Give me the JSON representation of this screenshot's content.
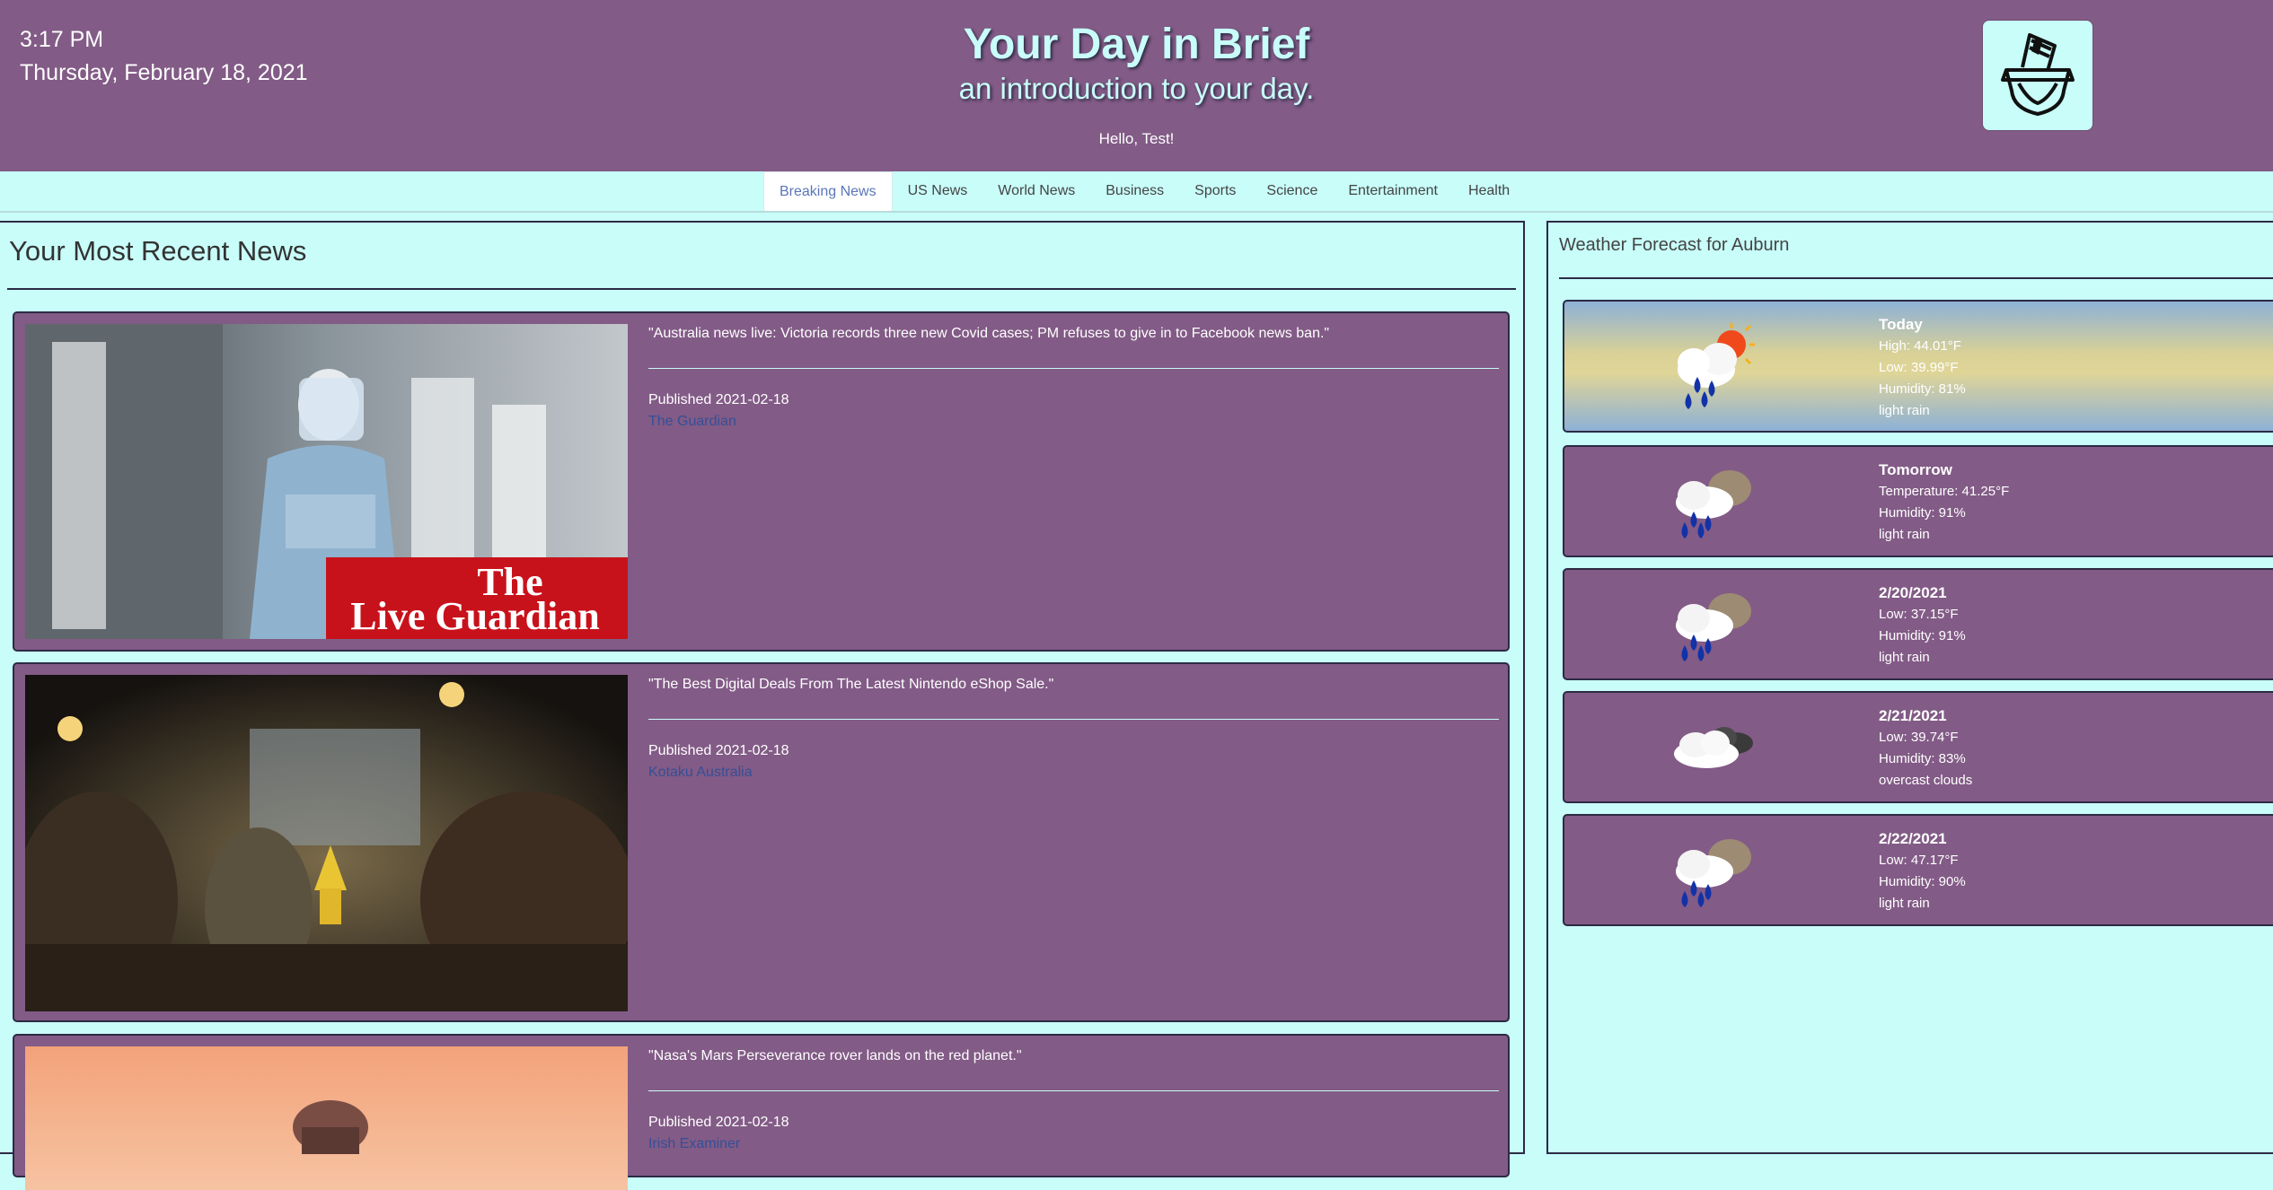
{
  "header": {
    "time": "3:17 PM",
    "date": "Thursday, February 18, 2021",
    "title": "Your Day in Brief",
    "subtitle": "an introduction to your day.",
    "greeting": "Hello, Test!",
    "logo_icon": "newspaper-basket-icon"
  },
  "nav": {
    "tabs": [
      "Breaking News",
      "US News",
      "World News",
      "Business",
      "Sports",
      "Science",
      "Entertainment",
      "Health"
    ],
    "active": "Breaking News"
  },
  "news": {
    "heading": "Your Most Recent News",
    "articles": [
      {
        "headline": "\"Australia news live: Victoria records three new Covid cases; PM refuses to give in to Facebook news ban.\"",
        "published": "Published 2021-02-18",
        "source": "The Guardian",
        "image_text_1": "The",
        "image_text_2": "Live Guardian"
      },
      {
        "headline": "\"The Best Digital Deals From The Latest Nintendo eShop Sale.\"",
        "published": "Published 2021-02-18",
        "source": "Kotaku Australia"
      },
      {
        "headline": "\"Nasa's Mars Perseverance rover lands on the red planet.\"",
        "published": "Published 2021-02-18",
        "source": "Irish Examiner"
      }
    ]
  },
  "weather": {
    "heading": "Weather Forecast for Auburn",
    "days": [
      {
        "day": "Today",
        "line1": "High: 44.01°F",
        "line2": "Low: 39.99°F",
        "line3": "Humidity: 81%",
        "line4": "light rain",
        "icon": "rain-sun-icon"
      },
      {
        "day": "Tomorrow",
        "line1": "Temperature: 41.25°F",
        "line2": "Humidity: 91%",
        "line3": "light rain",
        "icon": "rain-cloud-icon"
      },
      {
        "day": "2/20/2021",
        "line1": "Low: 37.15°F",
        "line2": "Humidity: 91%",
        "line3": "light rain",
        "icon": "rain-cloud-icon"
      },
      {
        "day": "2/21/2021",
        "line1": "Low: 39.74°F",
        "line2": "Humidity: 83%",
        "line3": "overcast clouds",
        "icon": "overcast-clouds-icon"
      },
      {
        "day": "2/22/2021",
        "line1": "Low: 47.17°F",
        "line2": "Humidity: 90%",
        "line3": "light rain",
        "icon": "rain-cloud-icon"
      }
    ]
  }
}
